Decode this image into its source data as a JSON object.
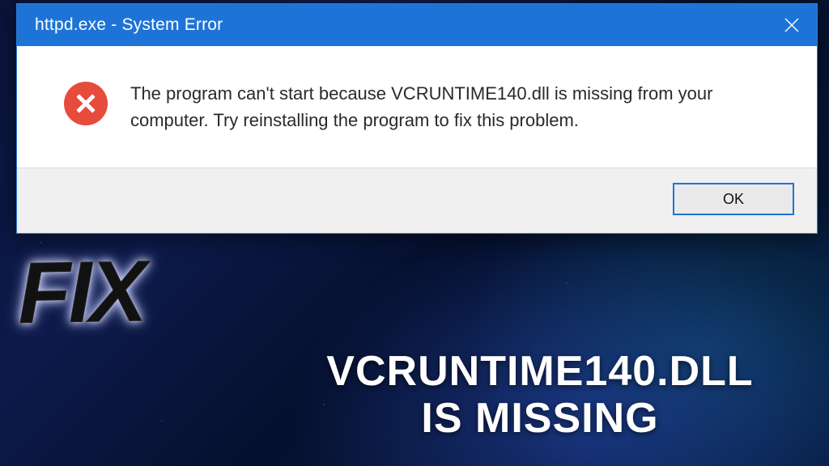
{
  "dialog": {
    "title": "httpd.exe - System Error",
    "message": "The program can't start because VCRUNTIME140.dll is missing from your computer. Try reinstalling the program to fix this problem.",
    "ok_label": "OK"
  },
  "overlay": {
    "fix": "FIX",
    "caption_line1": "VCRUNTIME140.DLL",
    "caption_line2": "IS MISSING"
  },
  "colors": {
    "titlebar": "#1e74d6",
    "error_icon": "#e64b3c",
    "button_border": "#1e74d6"
  }
}
